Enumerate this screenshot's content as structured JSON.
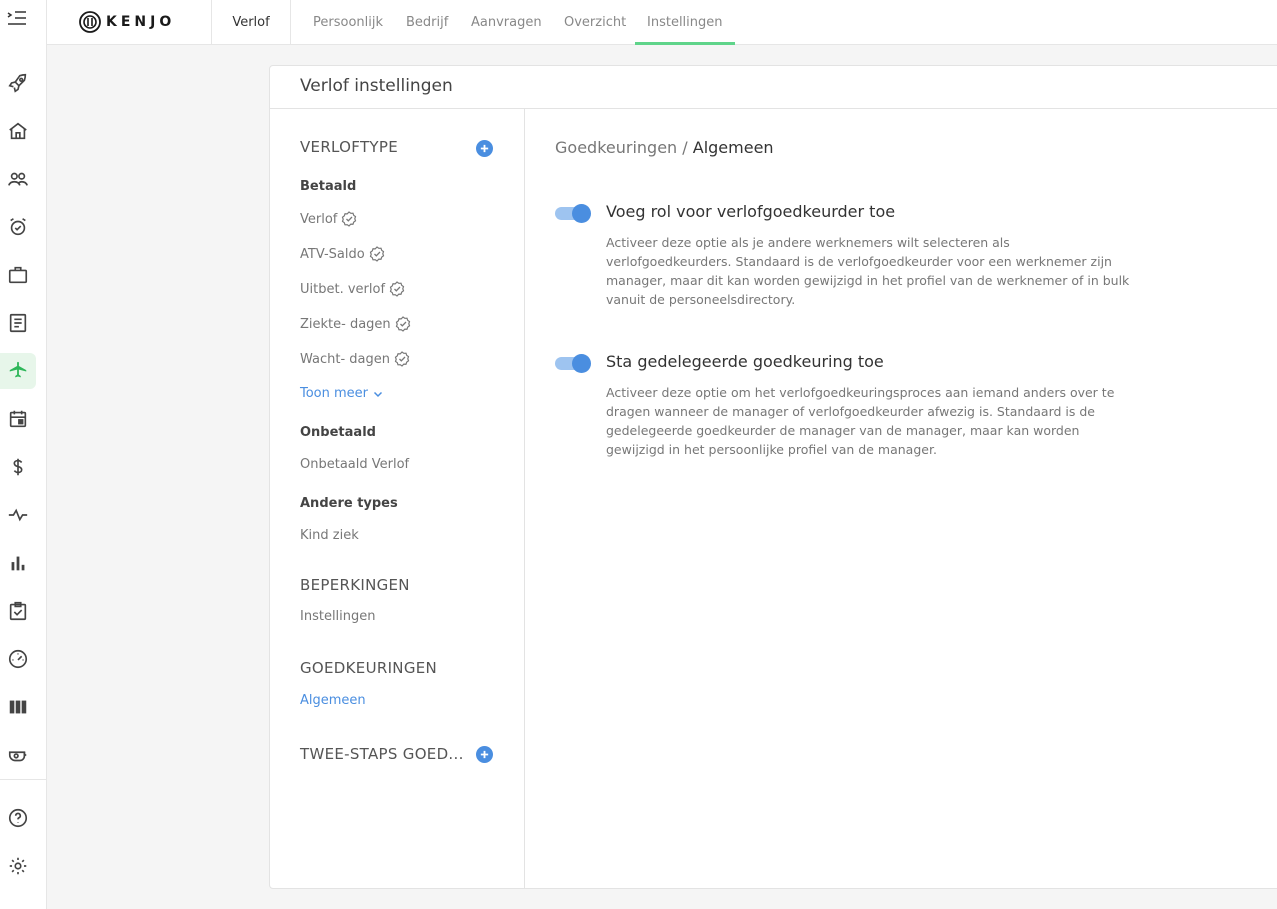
{
  "brand": {
    "name": "KENJO"
  },
  "topbar": {
    "section": "Verlof",
    "tabs": [
      {
        "label": "Persoonlijk"
      },
      {
        "label": "Bedrijf"
      },
      {
        "label": "Aanvragen"
      },
      {
        "label": "Overzicht"
      },
      {
        "label": "Instellingen",
        "active": true
      }
    ]
  },
  "rail": {
    "items": [
      {
        "icon": "rocket-icon"
      },
      {
        "icon": "home-icon"
      },
      {
        "icon": "people-icon"
      },
      {
        "icon": "alarm-clock-icon"
      },
      {
        "icon": "briefcase-icon"
      },
      {
        "icon": "document-icon"
      },
      {
        "icon": "airplane-icon",
        "active": true
      },
      {
        "icon": "calendar-icon"
      },
      {
        "icon": "dollar-icon"
      },
      {
        "icon": "pulse-icon"
      },
      {
        "icon": "bar-chart-icon"
      },
      {
        "icon": "checklist-icon"
      },
      {
        "icon": "gauge-icon"
      },
      {
        "icon": "columns-icon"
      },
      {
        "icon": "whistle-icon"
      }
    ],
    "bottom": [
      {
        "icon": "help-icon"
      },
      {
        "icon": "settings-gear-icon"
      }
    ]
  },
  "card": {
    "title": "Verlof instellingen"
  },
  "settings_nav": {
    "verloftype": {
      "heading": "VERLOFTYPE",
      "paid_group": "Betaald",
      "paid_items": [
        {
          "label": "Verlof"
        },
        {
          "label": "ATV-Saldo"
        },
        {
          "label": "Uitbet. verlof"
        },
        {
          "label": "Ziekte- dagen"
        },
        {
          "label": "Wacht- dagen"
        }
      ],
      "show_more": "Toon meer",
      "unpaid_group": "Onbetaald",
      "unpaid_items": [
        {
          "label": "Onbetaald Verlof"
        }
      ],
      "other_group": "Andere types",
      "other_items": [
        {
          "label": "Kind ziek"
        }
      ]
    },
    "beperkingen": {
      "heading": "BEPERKINGEN",
      "items": [
        {
          "label": "Instellingen"
        }
      ]
    },
    "goedkeuringen": {
      "heading": "GOEDKEURINGEN",
      "items": [
        {
          "label": "Algemeen",
          "active": true
        }
      ]
    },
    "twee_staps": {
      "heading": "TWEE-STAPS GOED..."
    }
  },
  "content": {
    "breadcrumb_parent": "Goedkeuringen",
    "breadcrumb_sep": "/",
    "breadcrumb_current": "Algemeen",
    "settings": [
      {
        "title": "Voeg rol voor verlofgoedkeurder toe",
        "enabled": true,
        "description": "Activeer deze optie als je andere werknemers wilt selecteren als verlofgoedkeurders. Standaard is de verlofgoedkeurder voor een werknemer zijn manager, maar dit kan worden gewijzigd in het profiel van de werknemer of in bulk vanuit de personeelsdirectory."
      },
      {
        "title": "Sta gedelegeerde goedkeuring toe",
        "enabled": true,
        "description": "Activeer deze optie om het verlofgoedkeuringsproces aan iemand anders over te dragen wanneer de manager of verlofgoedkeurder afwezig is. Standaard is de gedelegeerde goedkeurder de manager van de manager, maar kan worden gewijzigd in het persoonlijke profiel van de manager."
      }
    ]
  },
  "colors": {
    "accent": "#4a8ee0",
    "active_tab_underline": "#5fd48a",
    "active_rail": "#2fb75a"
  }
}
